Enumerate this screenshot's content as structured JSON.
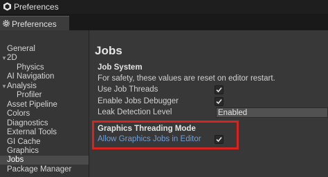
{
  "window": {
    "title": "Preferences"
  },
  "tab": {
    "label": "Preferences"
  },
  "sidebar": {
    "items": [
      {
        "label": "General",
        "indent": 0,
        "caret": false,
        "selected": false
      },
      {
        "label": "2D",
        "indent": 0,
        "caret": true,
        "selected": false
      },
      {
        "label": "Physics",
        "indent": 1,
        "caret": false,
        "selected": false
      },
      {
        "label": "AI Navigation",
        "indent": 0,
        "caret": false,
        "selected": false
      },
      {
        "label": "Analysis",
        "indent": 0,
        "caret": true,
        "selected": false
      },
      {
        "label": "Profiler",
        "indent": 1,
        "caret": false,
        "selected": false
      },
      {
        "label": "Asset Pipeline",
        "indent": 0,
        "caret": false,
        "selected": false
      },
      {
        "label": "Colors",
        "indent": 0,
        "caret": false,
        "selected": false
      },
      {
        "label": "Diagnostics",
        "indent": 0,
        "caret": false,
        "selected": false
      },
      {
        "label": "External Tools",
        "indent": 0,
        "caret": false,
        "selected": false
      },
      {
        "label": "GI Cache",
        "indent": 0,
        "caret": false,
        "selected": false
      },
      {
        "label": "Graphics",
        "indent": 0,
        "caret": false,
        "selected": false
      },
      {
        "label": "Jobs",
        "indent": 0,
        "caret": false,
        "selected": true
      },
      {
        "label": "Package Manager",
        "indent": 0,
        "caret": false,
        "selected": false
      }
    ]
  },
  "main": {
    "heading": "Jobs",
    "job_system": {
      "title": "Job System",
      "note": "For safety, these values are reset on editor restart.",
      "use_job_threads": {
        "label": "Use Job Threads",
        "checked": true
      },
      "enable_jobs_debugger": {
        "label": "Enable Jobs Debugger",
        "checked": true
      },
      "leak_detection": {
        "label": "Leak Detection Level",
        "value": "Enabled"
      }
    },
    "graphics_threading": {
      "title": "Graphics Threading Mode",
      "allow_graphics_jobs": {
        "label": "Allow Graphics Jobs in Editor",
        "checked": true
      }
    }
  },
  "colors": {
    "highlight": "#d8231e",
    "link": "#6f9fd8"
  },
  "icons": {
    "titlebar": "unity-logo-icon",
    "tab": "gear-icon",
    "check": "checkmark-icon"
  }
}
